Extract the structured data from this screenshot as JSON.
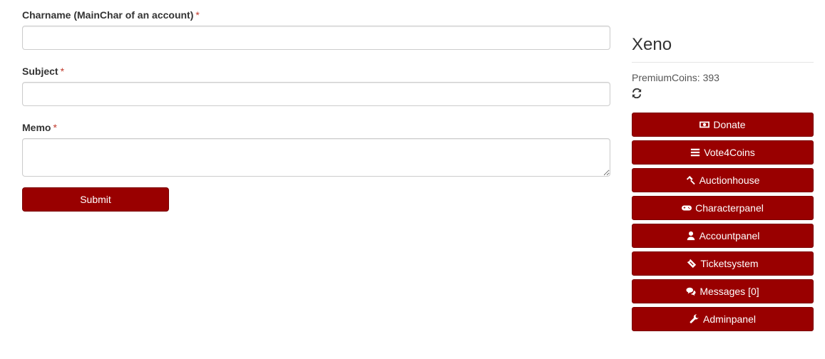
{
  "form": {
    "charname_label": "Charname (MainChar of an account)",
    "subject_label": "Subject",
    "memo_label": "Memo",
    "required_marker": "*",
    "submit_label": "Submit"
  },
  "sidebar": {
    "username": "Xeno",
    "coins_text": "PremiumCoins: 393",
    "items": [
      {
        "label": "Donate",
        "icon": "money-icon"
      },
      {
        "label": "Vote4Coins",
        "icon": "list-icon"
      },
      {
        "label": "Auctionhouse",
        "icon": "gavel-icon"
      },
      {
        "label": "Characterpanel",
        "icon": "gamepad-icon"
      },
      {
        "label": "Accountpanel",
        "icon": "user-icon"
      },
      {
        "label": "Ticketsystem",
        "icon": "ticket-icon"
      },
      {
        "label": "Messages [0]",
        "icon": "comments-icon"
      },
      {
        "label": "Adminpanel",
        "icon": "wrench-icon"
      }
    ]
  },
  "colors": {
    "button_bg": "#990000",
    "required": "#c0392b"
  }
}
